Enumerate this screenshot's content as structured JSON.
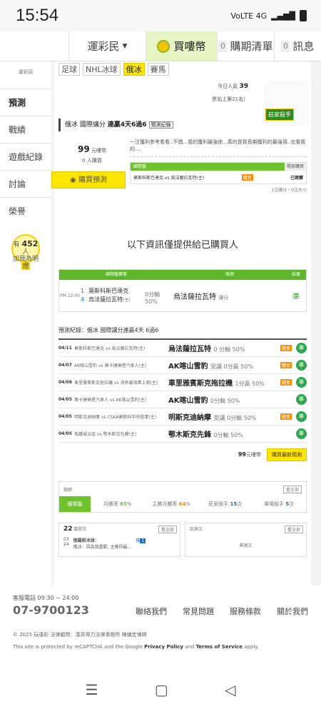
{
  "status": {
    "time": "15:54",
    "net": "VoLTE 4G",
    "signal": "▂▄▆█"
  },
  "topnav": {
    "brand": "運彩民",
    "buy": "買嘍幣",
    "schedule_count": "0",
    "schedule": "購期清單",
    "msg_count": "0",
    "msg": "訊息"
  },
  "sidebar": {
    "logo": "運彩民",
    "items": [
      "預測",
      "戰績",
      "遊戲紀錄",
      "討論",
      "榮譽"
    ],
    "help_prefix": "有",
    "help_count": "452",
    "help_unit": "人",
    "help_text": "加我為明燈"
  },
  "sports": [
    "足球",
    "NHL冰球",
    "俄冰",
    "賽馬"
  ],
  "stats": {
    "popularity_label": "今日人氣",
    "popularity": "39",
    "rank": "昰站上第21名！"
  },
  "mascot": {
    "tag": "莊家殺手"
  },
  "title": {
    "league": "俄冰 國際讓分",
    "streak": "連贏4天6過6",
    "rec": "預測紀錄"
  },
  "pick": {
    "price": "99",
    "price_unit": "元嘍幣",
    "buyers": "0 人購買",
    "buy_btn": "購買預測",
    "desc": "一注獲利參考看看..不錯...我的獲利最強他...真的是我長期獲利的最強項..也看我的....",
    "mini_header": "國際盤",
    "mini_btn": "開放購買",
    "match": "莫斯科斯巴達克 vs 烏法薩拉瓦特(主)",
    "mini_buy": "購買",
    "mini_status": "已閱賽",
    "note": "1注讓分・0注大小"
  },
  "notice": "以下資訊僅提供給已購買人",
  "ptable": {
    "headers": [
      "國際盤賽事",
      "預測",
      "結果"
    ],
    "time": "PM 22:00",
    "home_no": "1",
    "home": "莫斯科斯巴達克",
    "away_no": "4",
    "away": "烏法薩拉瓦特",
    "away_tag": "(主)",
    "line1": "0分輸",
    "line2": "50%",
    "pred": "烏法薩拉瓦特",
    "pred_type": "讓分",
    "result": "準"
  },
  "hist_title": "預測紀錄：俄冰 國際讓分連贏4天 6過6",
  "history": [
    {
      "date": "04/11",
      "match": "莫斯科斯巴達克 vs 烏法薩拉瓦特(主)",
      "pick": "烏法薩拉瓦特",
      "line": "0 分輸 50%",
      "x": "購買",
      "res": "準"
    },
    {
      "date": "04/07",
      "match": "AK喀山雪豹 vs 莫卡捷琳堡汽車人(主)",
      "pick": "AK喀山雪豹",
      "line": "受讓 0分贏 50%",
      "x": "購買",
      "res": "準"
    },
    {
      "date": "04/06",
      "match": "車里雅賓斯克拖拉機 vs 海參崴海軍上將(主)",
      "pick": "車里雅賓斯克拖拉機",
      "line": "1分贏 50%",
      "x": "購買",
      "res": "準"
    },
    {
      "date": "04/05",
      "match": "葉卡捷琳堡汽車人 vs AK喀山雪豹(主)",
      "pick": "AK喀山雪豹",
      "line": "0分輸 50%",
      "x": "",
      "res": "準"
    },
    {
      "date": "04/05",
      "match": "明斯克迪納摩 vs CSKA莫斯科中央陸軍(主)",
      "pick": "明斯克迪納摩",
      "line": "受讓 0分輸 50%",
      "x": "購買",
      "res": "準"
    },
    {
      "date": "04/05",
      "match": "馬鐵城冶金 vs 鄂木斯克先鋒(主)",
      "pick": "鄂木斯克先鋒",
      "line": "0分輸 50%",
      "x": "",
      "res": "準"
    }
  ],
  "buyrow": {
    "price": "99",
    "unit": "元嘍幣",
    "btn": "購買最新預測"
  },
  "record": {
    "label": "戰績",
    "all": "看全部",
    "tab": "國際盤",
    "month_label": "月勝率",
    "month": "65",
    "main_label": "主勝月勝率",
    "main": "64",
    "killer_label": "莊家殺手",
    "killer": "15",
    "killer_unit": "次",
    "single_label": "單場殺手",
    "single": "5",
    "single_unit": "次",
    "pct": "%"
  },
  "boxes": {
    "posts_count": "22",
    "posts_label": "篇發文",
    "all": "看全部",
    "post_date1": "03",
    "post_date2": "24",
    "post_title": "俄羅斯冰球：",
    "post_body": "俄冰：因為我喜歡, 主推你最...",
    "post_tag": "推",
    "post_num": "1",
    "reply_label": "詬謝文",
    "reply_empty": "無謝文"
  },
  "footer": {
    "service": "客服電話 09:30 ~ 24:00",
    "phone": "07-9700123",
    "links": [
      "聯絡我們",
      "常見問題",
      "服務條款",
      "關於我們"
    ],
    "copyright": "© 2025 玩運彩 法律顧問：漢英得力法律事務所 陳鎮宏律師",
    "captcha_pre": "This site is protected by reCAPTCHA and the Google ",
    "privacy": "Privacy Policy",
    "and": " and ",
    "terms": "Terms of Service",
    "apply": " apply."
  },
  "navbar": {
    "menu": "☰",
    "home": "▢",
    "back": "◁"
  }
}
